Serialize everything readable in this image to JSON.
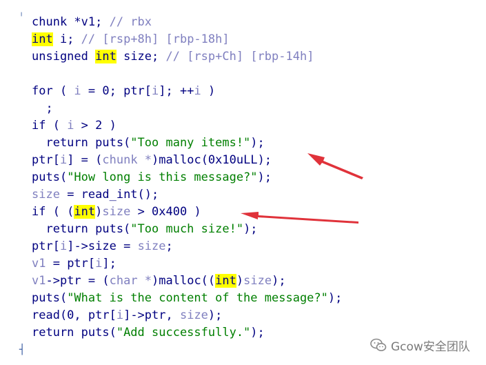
{
  "code": {
    "lines": [
      [
        {
          "t": "chunk *v1; ",
          "c": "plain"
        },
        {
          "t": "// rbx",
          "c": "cmt"
        }
      ],
      [
        {
          "t": "int",
          "c": "hl"
        },
        {
          "t": " i; ",
          "c": "plain"
        },
        {
          "t": "// [rsp+8h] [rbp-18h]",
          "c": "cmt"
        }
      ],
      [
        {
          "t": "unsigned ",
          "c": "plain"
        },
        {
          "t": "int",
          "c": "hl"
        },
        {
          "t": " size; ",
          "c": "plain"
        },
        {
          "t": "// [rsp+Ch] [rbp-14h]",
          "c": "cmt"
        }
      ],
      [],
      [
        {
          "t": "for ( ",
          "c": "plain"
        },
        {
          "t": "i",
          "c": "dim"
        },
        {
          "t": " = 0; ptr[",
          "c": "plain"
        },
        {
          "t": "i",
          "c": "dim"
        },
        {
          "t": "]; ++",
          "c": "plain"
        },
        {
          "t": "i",
          "c": "dim"
        },
        {
          "t": " )",
          "c": "plain"
        }
      ],
      [
        {
          "t": "  ;",
          "c": "plain"
        }
      ],
      [
        {
          "t": "if ( ",
          "c": "plain"
        },
        {
          "t": "i",
          "c": "dim"
        },
        {
          "t": " > 2 )",
          "c": "plain"
        }
      ],
      [
        {
          "t": "  return puts(",
          "c": "plain"
        },
        {
          "t": "\"Too many items!\"",
          "c": "str"
        },
        {
          "t": ");",
          "c": "plain"
        }
      ],
      [
        {
          "t": "ptr[",
          "c": "plain"
        },
        {
          "t": "i",
          "c": "dim"
        },
        {
          "t": "] = (",
          "c": "plain"
        },
        {
          "t": "chunk *",
          "c": "dim"
        },
        {
          "t": ")malloc(0x10uLL);",
          "c": "plain"
        }
      ],
      [
        {
          "t": "puts(",
          "c": "plain"
        },
        {
          "t": "\"How long is this message?\"",
          "c": "str"
        },
        {
          "t": ");",
          "c": "plain"
        }
      ],
      [
        {
          "t": "size",
          "c": "dim"
        },
        {
          "t": " = read_int();",
          "c": "plain"
        }
      ],
      [
        {
          "t": "if ( (",
          "c": "plain"
        },
        {
          "t": "int",
          "c": "hl"
        },
        {
          "t": ")",
          "c": "plain"
        },
        {
          "t": "size",
          "c": "dim"
        },
        {
          "t": " > 0x400 )",
          "c": "plain"
        }
      ],
      [
        {
          "t": "  return puts(",
          "c": "plain"
        },
        {
          "t": "\"Too much size!\"",
          "c": "str"
        },
        {
          "t": ");",
          "c": "plain"
        }
      ],
      [
        {
          "t": "ptr[",
          "c": "plain"
        },
        {
          "t": "i",
          "c": "dim"
        },
        {
          "t": "]->size = ",
          "c": "plain"
        },
        {
          "t": "size",
          "c": "dim"
        },
        {
          "t": ";",
          "c": "plain"
        }
      ],
      [
        {
          "t": "v1",
          "c": "dim"
        },
        {
          "t": " = ptr[",
          "c": "plain"
        },
        {
          "t": "i",
          "c": "dim"
        },
        {
          "t": "];",
          "c": "plain"
        }
      ],
      [
        {
          "t": "v1",
          "c": "dim"
        },
        {
          "t": "->ptr = (",
          "c": "plain"
        },
        {
          "t": "char *",
          "c": "dim"
        },
        {
          "t": ")malloc((",
          "c": "plain"
        },
        {
          "t": "int",
          "c": "hl"
        },
        {
          "t": ")",
          "c": "plain"
        },
        {
          "t": "size",
          "c": "dim"
        },
        {
          "t": ");",
          "c": "plain"
        }
      ],
      [
        {
          "t": "puts(",
          "c": "plain"
        },
        {
          "t": "\"What is the content of the message?\"",
          "c": "str"
        },
        {
          "t": ");",
          "c": "plain"
        }
      ],
      [
        {
          "t": "read(0, ptr[",
          "c": "plain"
        },
        {
          "t": "i",
          "c": "dim"
        },
        {
          "t": "]->ptr, ",
          "c": "plain"
        },
        {
          "t": "size",
          "c": "dim"
        },
        {
          "t": ");",
          "c": "plain"
        }
      ],
      [
        {
          "t": "return puts(",
          "c": "plain"
        },
        {
          "t": "\"Add successfully.\"",
          "c": "str"
        },
        {
          "t": ");",
          "c": "plain"
        }
      ]
    ]
  },
  "watermark": {
    "text": "Gcow安全团队",
    "icon": "wechat-icon"
  },
  "colors": {
    "identifier": "#000080",
    "comment": "#7f7fbf",
    "string": "#007f00",
    "highlight": "#ffff00",
    "arrow": "#e0323a"
  }
}
